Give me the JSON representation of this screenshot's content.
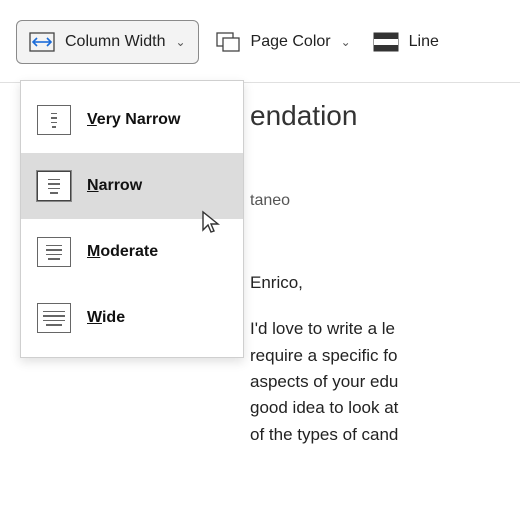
{
  "toolbar": {
    "column_width_label": "Column Width",
    "page_color_label": "Page Color",
    "line_label": "Line "
  },
  "dropdown": {
    "items": [
      {
        "label": "Very Narrow",
        "underline_html": "<span class='underline'>V</span>ery Narrow"
      },
      {
        "label": "Narrow",
        "underline_html": "<span class='underline'>N</span>arrow"
      },
      {
        "label": "Moderate",
        "underline_html": "<span class='underline'>M</span>oderate"
      },
      {
        "label": "Wide",
        "underline_html": "<span class='underline'>W</span>ide"
      }
    ],
    "selected_index": 1
  },
  "document": {
    "title_fragment": "endation",
    "author_fragment": "taneo",
    "greeting": "Enrico,",
    "body_lines": [
      "I'd love to write a le",
      "require a specific fo",
      "aspects of your edu",
      "good idea to look at",
      "of the types of cand"
    ]
  }
}
